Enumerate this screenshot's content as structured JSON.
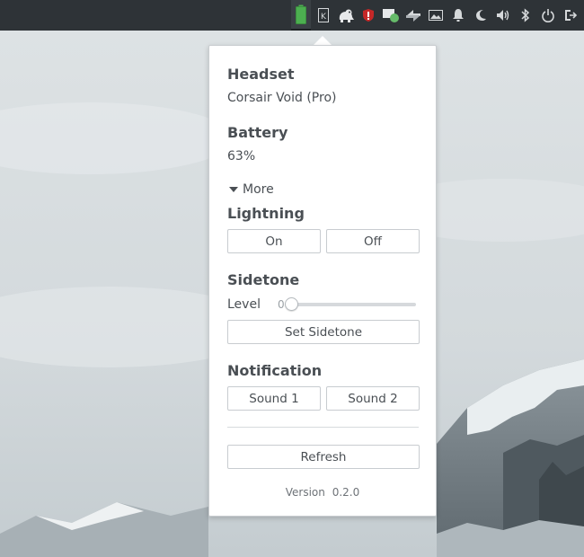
{
  "panel": {
    "tray_icons": [
      "battery-icon",
      "keyboard-layout-icon",
      "pidgin-icon",
      "security-shield-icon",
      "chat-status-icon",
      "network-transfer-icon",
      "screenshot-icon",
      "notifications-bell-icon",
      "night-mode-icon",
      "volume-icon",
      "bluetooth-icon",
      "power-icon",
      "logout-icon"
    ],
    "battery_color": "#4caf50"
  },
  "popup": {
    "headset": {
      "title": "Headset",
      "value": "Corsair Void (Pro)"
    },
    "battery": {
      "title": "Battery",
      "value": "63%"
    },
    "more_label": "More",
    "lightning": {
      "title": "Lightning",
      "on_label": "On",
      "off_label": "Off"
    },
    "sidetone": {
      "title": "Sidetone",
      "level_label": "Level",
      "level_value": "0",
      "level_fraction": 0,
      "set_label": "Set Sidetone"
    },
    "notification": {
      "title": "Notification",
      "sound1_label": "Sound 1",
      "sound2_label": "Sound 2"
    },
    "refresh_label": "Refresh",
    "version": {
      "label": "Version",
      "number": "0.2.0"
    }
  }
}
